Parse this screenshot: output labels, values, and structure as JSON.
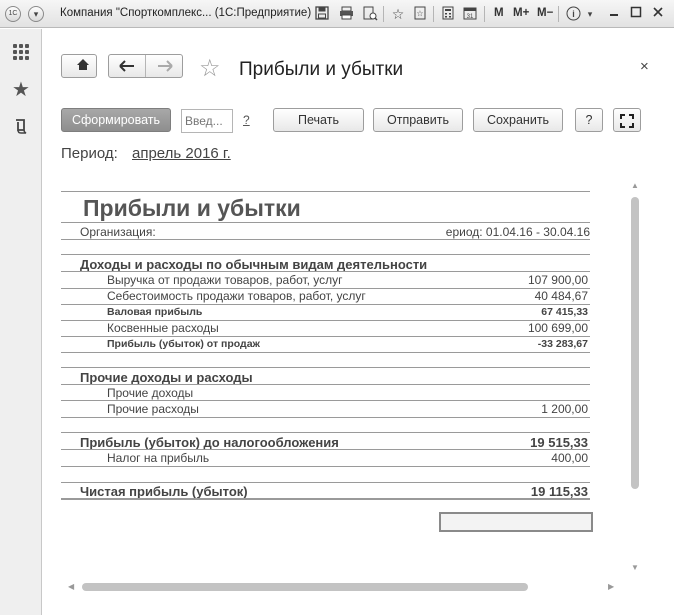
{
  "window": {
    "title": "Компания \"Спорткомплекс... (1С:Предприятие)",
    "logo_text": "1С",
    "m_label": "M",
    "mplus_label": "M+",
    "mminus_label": "M−"
  },
  "form": {
    "title": "Прибыли и убытки",
    "close_glyph": "×"
  },
  "toolbar": {
    "generate_label": "Сформировать",
    "input_placeholder": "Введ...",
    "question_label": "?",
    "print_label": "Печать",
    "send_label": "Отправить",
    "save_label": "Сохранить",
    "help_label": "?"
  },
  "period": {
    "label": "Период:",
    "value": "апрель 2016 г."
  },
  "report": {
    "title": "Прибыли и убытки",
    "org_label": "Организация:",
    "period_text": "ериод: 01.04.16 - 30.04.16",
    "sections": {
      "ordinary": {
        "heading": "Доходы и расходы по обычным видам деятельности",
        "rows": [
          {
            "label": "Выручка от продажи товаров, работ, услуг",
            "value": "107 900,00"
          },
          {
            "label": "Себестоимость продажи товаров, работ, услуг",
            "value": "40 484,67"
          },
          {
            "label": "Валовая прибыль",
            "value": "67 415,33"
          },
          {
            "label": "Косвенные расходы",
            "value": "100 699,00"
          },
          {
            "label": "Прибыль (убыток) от продаж",
            "value": "-33 283,67"
          }
        ]
      },
      "other": {
        "heading": "Прочие доходы и расходы",
        "rows": [
          {
            "label": "Прочие доходы",
            "value": ""
          },
          {
            "label": "Прочие расходы",
            "value": "1 200,00"
          }
        ]
      },
      "pretax": {
        "heading": "Прибыль (убыток) до налогообложения",
        "value": "19 515,33",
        "rows": [
          {
            "label": "Налог на прибыль",
            "value": "400,00"
          }
        ]
      },
      "net": {
        "heading": "Чистая прибыль (убыток)",
        "value": "19 115,33"
      }
    }
  },
  "icons": [
    "menu-grid-icon",
    "favorites-star-icon",
    "history-icon",
    "home-icon",
    "back-arrow-icon",
    "forward-arrow-icon",
    "star-icon",
    "close-icon",
    "fullscreen-icon",
    "save-disk-icon",
    "print-icon",
    "preview-icon",
    "bookmark-icon",
    "calculator-icon",
    "calendar-icon",
    "info-icon"
  ]
}
